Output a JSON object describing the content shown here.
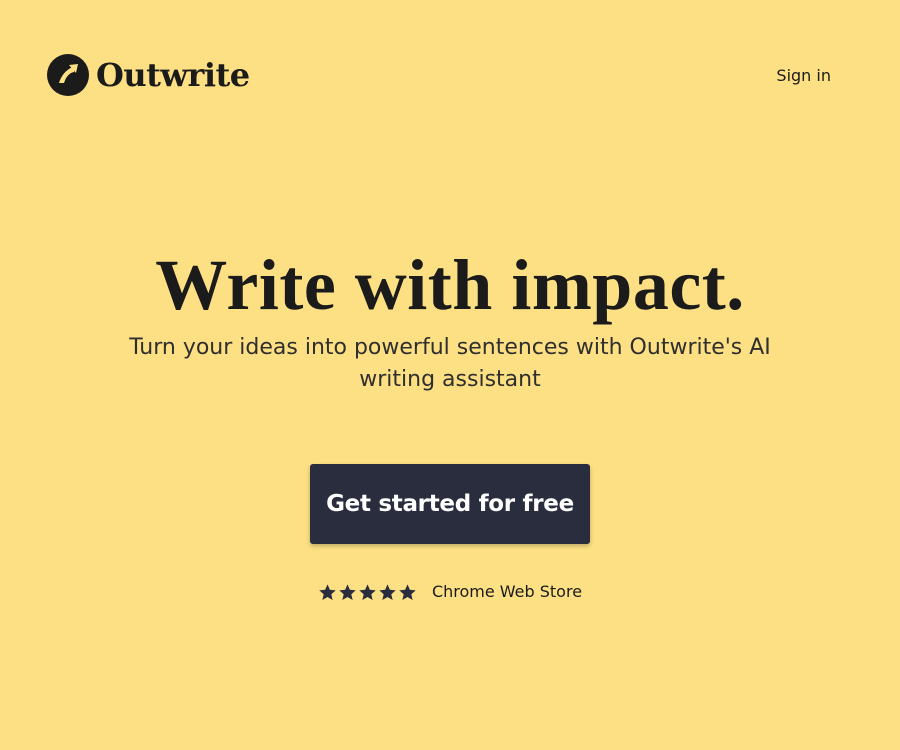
{
  "header": {
    "brand_name": "Outwrite",
    "brand_icon": "outwrite-logo-icon",
    "signin_label": "Sign in"
  },
  "hero": {
    "headline": "Write with impact.",
    "subline": "Turn your ideas into powerful sentences with Outwrite's AI writing assistant",
    "cta_label": "Get started for free"
  },
  "rating": {
    "stars": 5,
    "max_stars": 5,
    "star_icon": "star-icon",
    "source": "Chrome Web Store"
  },
  "colors": {
    "background": "#fce083",
    "text": "#1b1b1b",
    "button": "#2a2d3d",
    "button_text": "#ffffff"
  }
}
